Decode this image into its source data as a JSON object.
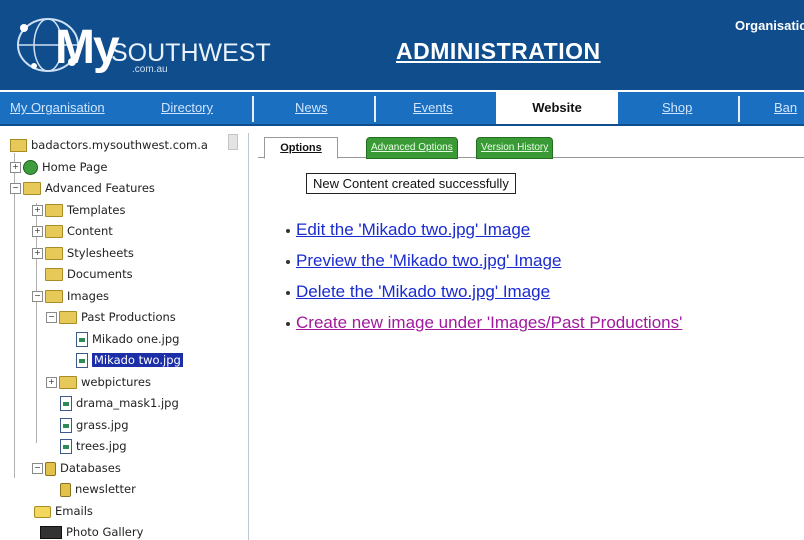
{
  "header": {
    "logo_main": "My",
    "logo_sub": "SOUTHWEST",
    "logo_domain": ".com.au",
    "title": "ADMINISTRATION",
    "organisation_label": "Organisatio"
  },
  "nav": {
    "tabs": [
      {
        "label": "My Organisation",
        "active": false
      },
      {
        "label": "Directory",
        "active": false
      },
      {
        "label": "News",
        "active": false
      },
      {
        "label": "Events",
        "active": false
      },
      {
        "label": "Website",
        "active": true
      },
      {
        "label": "Shop",
        "active": false
      },
      {
        "label": "Ban",
        "active": false
      }
    ]
  },
  "tree": {
    "root": "badactors.mysouthwest.com.a",
    "items": [
      {
        "label": "Home Page",
        "icon": "globe-icon"
      },
      {
        "label": "Advanced Features",
        "icon": "folder-icon"
      },
      {
        "label": "Templates",
        "icon": "folder-icon"
      },
      {
        "label": "Content",
        "icon": "folder-icon"
      },
      {
        "label": "Stylesheets",
        "icon": "folder-icon"
      },
      {
        "label": "Documents",
        "icon": "folder-icon"
      },
      {
        "label": "Images",
        "icon": "folder-icon"
      },
      {
        "label": "Past Productions",
        "icon": "folder-icon"
      },
      {
        "label": "Mikado one.jpg",
        "icon": "image-file-icon"
      },
      {
        "label": "Mikado two.jpg",
        "icon": "image-file-icon",
        "selected": true
      },
      {
        "label": "webpictures",
        "icon": "folder-icon"
      },
      {
        "label": "drama_mask1.jpg",
        "icon": "image-file-icon"
      },
      {
        "label": "grass.jpg",
        "icon": "image-file-icon"
      },
      {
        "label": "trees.jpg",
        "icon": "image-file-icon"
      },
      {
        "label": "Databases",
        "icon": "database-icon"
      },
      {
        "label": "newsletter",
        "icon": "database-icon"
      },
      {
        "label": "Emails",
        "icon": "email-icon"
      },
      {
        "label": "Photo Gallery",
        "icon": "film-icon"
      }
    ]
  },
  "content": {
    "tabs": [
      {
        "label": "Options",
        "active": true
      },
      {
        "label": "Advanced Options",
        "active": false
      },
      {
        "label": "Version History",
        "active": false
      }
    ],
    "status_message": "New Content created successfully",
    "links": [
      {
        "label": "Edit the 'Mikado two.jpg' Image",
        "visited": false
      },
      {
        "label": "Preview the 'Mikado two.jpg' Image",
        "visited": false
      },
      {
        "label": "Delete the 'Mikado two.jpg' Image",
        "visited": false
      },
      {
        "label": "Create new image under 'Images/Past Productions'",
        "visited": true
      }
    ]
  },
  "colors": {
    "header_bg": "#0f4d8c",
    "nav_bg": "#1b6fc0",
    "green_tab": "#3a9a35",
    "link": "#1a2bd0",
    "visited_link": "#a01a9e",
    "selection": "#1c2fa8"
  }
}
